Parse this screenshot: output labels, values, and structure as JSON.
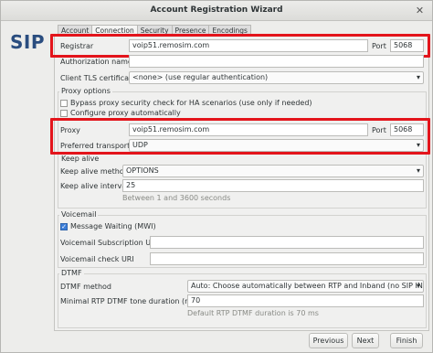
{
  "window": {
    "title": "Account Registration Wizard"
  },
  "logo": {
    "text": "SIP"
  },
  "tabs": [
    {
      "label": "Account"
    },
    {
      "label": "Connection"
    },
    {
      "label": "Security"
    },
    {
      "label": "Presence"
    },
    {
      "label": "Encodings"
    }
  ],
  "registrar": {
    "label": "Registrar",
    "value": "voip51.remosim.com",
    "port_label": "Port",
    "port": "5068"
  },
  "auth_name": {
    "label": "Authorization name",
    "value": ""
  },
  "tls": {
    "label": "Client TLS certificate",
    "value": "<none> (use regular authentication)"
  },
  "proxy_options": {
    "label": "Proxy options",
    "bypass_label": "Bypass proxy security check for HA scenarios (use only if needed)",
    "bypass_checked": false,
    "configure_label": "Configure proxy automatically",
    "configure_checked": false
  },
  "proxy": {
    "label": "Proxy",
    "value": "voip51.remosim.com",
    "port_label": "Port",
    "port": "5068"
  },
  "transport": {
    "label": "Preferred transport",
    "value": "UDP"
  },
  "keep_alive": {
    "label": "Keep alive",
    "method_label": "Keep alive method",
    "method_value": "OPTIONS",
    "interval_label": "Keep alive interval",
    "interval_value": "25",
    "interval_hint": "Between 1 and 3600 seconds"
  },
  "voicemail": {
    "label": "Voicemail",
    "mwi_label": "Message Waiting (MWI)",
    "mwi_checked": true,
    "subscription_label": "Voicemail Subscription URI",
    "subscription_value": "",
    "check_label": "Voicemail check URI",
    "check_value": ""
  },
  "dtmf": {
    "label": "DTMF",
    "method_label": "DTMF method",
    "method_value": "Auto: Choose automatically between RTP and Inband (no SIP INF...",
    "min_label": "Minimal RTP DTMF tone duration (ms)",
    "min_value": "70",
    "min_hint": "Default RTP DTMF duration is 70 ms"
  },
  "buttons": {
    "previous": "Previous",
    "next": "Next",
    "finish": "Finish"
  },
  "colors": {
    "highlight": "#e3141b",
    "accent": "#3b7dd8",
    "logo": "#2a4d7f"
  },
  "icons": {
    "close": "close-icon",
    "dropdown": "chevron-down-icon",
    "check": "checkmark-icon"
  }
}
